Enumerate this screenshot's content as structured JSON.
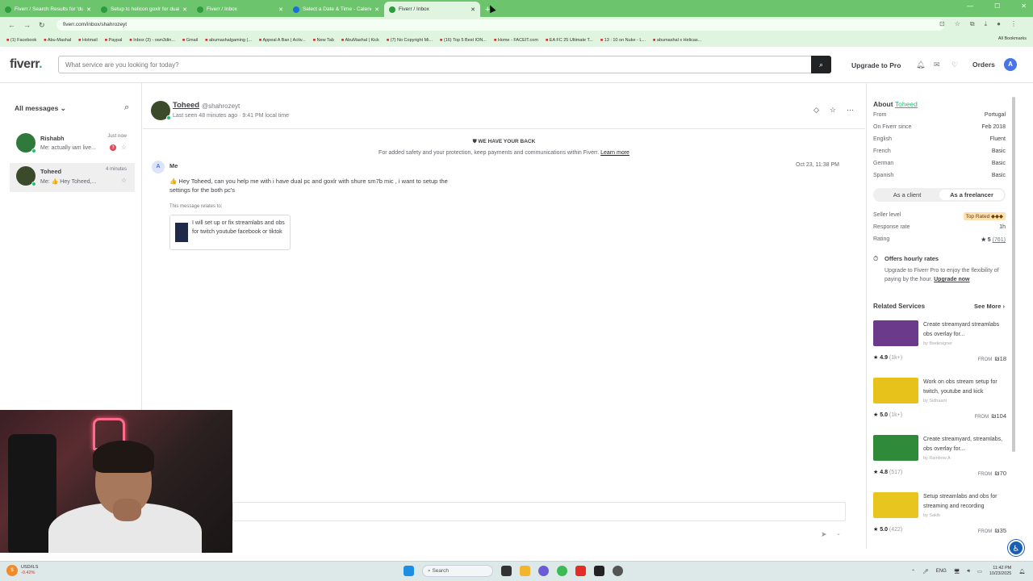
{
  "browser": {
    "tabs": [
      {
        "title": "Fiverr / Search Results for 'dual"
      },
      {
        "title": "Setup tc helicon goxlr for dual"
      },
      {
        "title": "Fiverr / Inbox"
      },
      {
        "title": "Select a Date & Time - Calendly"
      },
      {
        "title": "Fiverr / Inbox",
        "active": true
      }
    ],
    "new_tab": "+",
    "url": "fiverr.com/inbox/shahrozeyt",
    "bookmarks": [
      "(1) Facebook",
      "Abu-Mashal",
      "Hotmail",
      "Paypal",
      "Inbox (3) - own3din...",
      "Gmail",
      "abumashalgaming (...",
      "Appeal A Ban | Activ...",
      "New Tab",
      "AbuMashal | Kick",
      "(7) No Copyright Mi...",
      "(16) Top 5 Best ION...",
      "Home - FACEIT.com",
      "EA FC 25 Ultimate T...",
      "13 : 10 on Nuke - L...",
      "abumashal x Helicas..."
    ],
    "all_bookmarks": "All Bookmarks"
  },
  "header": {
    "logo": "fiverr",
    "logo_dot": ".",
    "search_placeholder": "What service are you looking for today?",
    "upgrade": "Upgrade to Pro",
    "orders": "Orders",
    "avatar": "A"
  },
  "sidebar": {
    "title": "All messages",
    "conversations": [
      {
        "name": "Rishabh",
        "preview": "Me: actually iam live...",
        "time": "Just now",
        "badge": "3"
      },
      {
        "name": "Toheed",
        "preview": "Me: 👍 Hey Toheed,...",
        "time": "4 minutes"
      }
    ]
  },
  "chat": {
    "username": "Toheed",
    "handle": "@shahrozeyt",
    "last_seen": "Last seen 48 minutes ago  ·  9:41 PM local time",
    "safety_title": "WE HAVE YOUR BACK",
    "safety_text": "For added safety and your protection, keep payments and communications within Fiverr.",
    "learn_more": "Learn more",
    "message": {
      "avatar": "A",
      "sender": "Me",
      "time": "Oct 23, 11:38 PM",
      "text": "👍 Hey Toheed, can you help me with i have dual pc and goxlr with shure sm7b mic , i want to setup the settings for the both pc's",
      "relates_label": "This message relates to:",
      "gig_title": "I will set up or fix streamlabs and obs for twitch youtube facebook or tiktok"
    }
  },
  "about": {
    "heading": "About",
    "name": "Toheed",
    "rows": [
      {
        "label": "From",
        "value": "Portugal"
      },
      {
        "label": "On Fiverr since",
        "value": "Feb 2018"
      },
      {
        "label": "English",
        "value": "Fluent"
      },
      {
        "label": "French",
        "value": "Basic"
      },
      {
        "label": "German",
        "value": "Basic"
      },
      {
        "label": "Spanish",
        "value": "Basic"
      }
    ],
    "toggle": {
      "client": "As a client",
      "freelancer": "As a freelancer"
    },
    "seller_level_label": "Seller level",
    "seller_level": "Top Rated ◆◆◆",
    "response_label": "Response rate",
    "response": "1h",
    "rating_label": "Rating",
    "rating": "5",
    "rating_count": "(761)",
    "hourly_title": "Offers hourly rates",
    "hourly_text": "Upgrade to Fiverr Pro to enjoy the flexibility of paying by the hour.",
    "hourly_link": "Upgrade now"
  },
  "related": {
    "title": "Related Services",
    "see_more": "See More",
    "from": "FROM",
    "items": [
      {
        "title": "Create streamyard streamlabs obs overlay for...",
        "by": "by Bwdesigner",
        "rating": "4.9",
        "count": "(1k+)",
        "price": "₪18",
        "color": "#6b3a8a"
      },
      {
        "title": "Work on obs stream setup for twitch, youtube and kick",
        "by": "by Sidhaant",
        "rating": "5.0",
        "count": "(1k+)",
        "price": "₪104",
        "color": "#e6c21a"
      },
      {
        "title": "Create streamyard, streamlabs, obs overlay for...",
        "by": "by Rainbow A",
        "rating": "4.8",
        "count": "(517)",
        "price": "₪70",
        "color": "#2f8a3a"
      },
      {
        "title": "Setup streamlabs and obs for streaming and recording",
        "by": "by Sakib",
        "rating": "5.0",
        "count": "(422)",
        "price": "₪35",
        "color": "#e8c51f"
      }
    ]
  },
  "taskbar": {
    "ticker": "USD/ILS",
    "ticker_change": "-0.42%",
    "search": "Search",
    "lang": "ENG",
    "time": "11:42 PM",
    "date": "10/23/2025"
  }
}
